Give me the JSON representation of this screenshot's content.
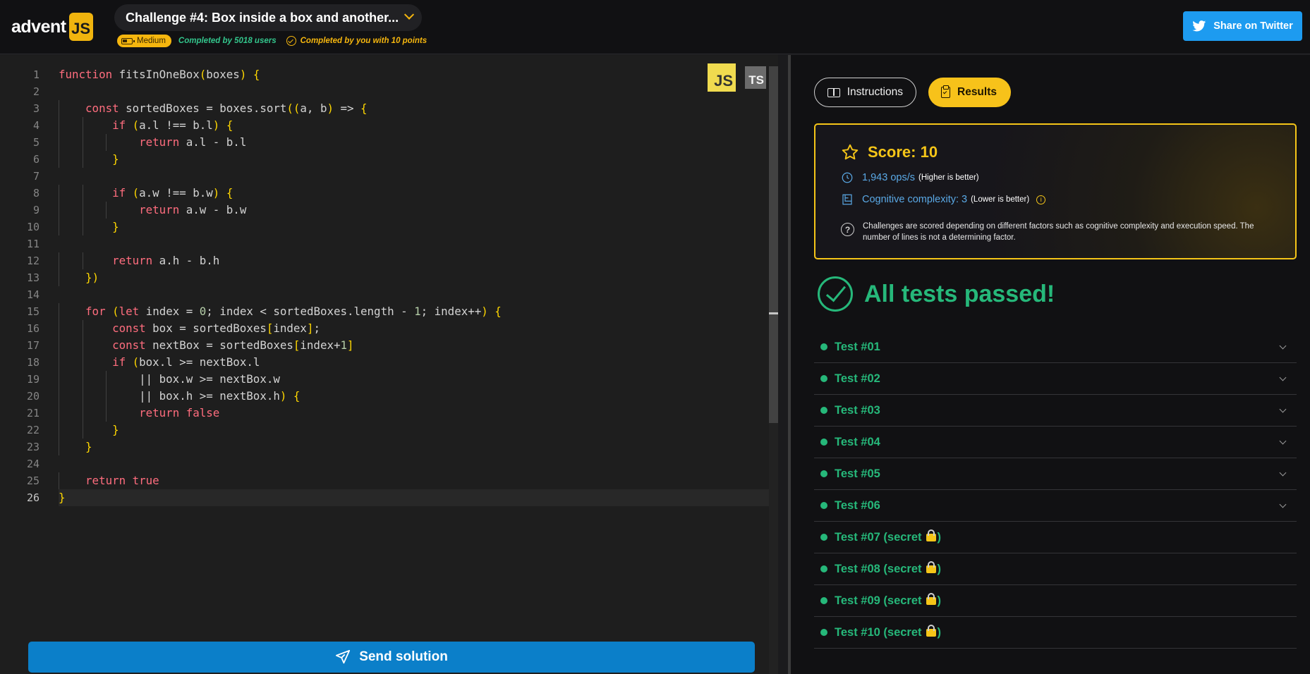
{
  "header": {
    "logo_text": "advent",
    "logo_badge": "JS",
    "challenge_title": "Challenge #4: Box inside a box and another...",
    "difficulty": "Medium",
    "completed_by_users": "Completed by 5018 users",
    "completed_by_you": "Completed by you with 10 points",
    "share_label": "Share on Twitter"
  },
  "editor": {
    "languages": [
      "JS",
      "TS"
    ],
    "active_language": "JS",
    "line_numbers": [
      "1",
      "2",
      "3",
      "4",
      "5",
      "6",
      "7",
      "8",
      "9",
      "10",
      "11",
      "12",
      "13",
      "14",
      "15",
      "16",
      "17",
      "18",
      "19",
      "20",
      "21",
      "22",
      "23",
      "24",
      "25",
      "26"
    ],
    "code_lines": [
      "function fitsInOneBox(boxes) {",
      "",
      "  const sortedBoxes = boxes.sort((a, b) => {",
      "    if (a.l !== b.l) {",
      "      return a.l - b.l",
      "    }",
      "",
      "    if (a.w !== b.w) {",
      "      return a.w - b.w",
      "    }",
      "",
      "    return a.h - b.h",
      "  })",
      "",
      "  for (let index = 0; index < sortedBoxes.length - 1; index++) {",
      "    const box = sortedBoxes[index];",
      "    const nextBox = sortedBoxes[index+1]",
      "    if (box.l >= nextBox.l",
      "      || box.w >= nextBox.w",
      "      || box.h >= nextBox.h) {",
      "      return false",
      "    }",
      "  }",
      "",
      "  return true",
      "}"
    ],
    "send_label": "Send solution"
  },
  "results": {
    "tabs": {
      "instructions": "Instructions",
      "results": "Results"
    },
    "active_tab": "Results",
    "score": "Score: 10",
    "ops": "1,943 ops/s",
    "ops_note": "(Higher is better)",
    "complexity": "Cognitive complexity: 3",
    "complexity_note": "(Lower is better)",
    "note": "Challenges are scored depending on different factors such as cognitive complexity and execution speed. The number of lines is not a determining factor.",
    "status": "All tests passed!",
    "tests": [
      {
        "label": "Test #01",
        "expandable": true
      },
      {
        "label": "Test #02",
        "expandable": true
      },
      {
        "label": "Test #03",
        "expandable": true
      },
      {
        "label": "Test #04",
        "expandable": true
      },
      {
        "label": "Test #05",
        "expandable": true
      },
      {
        "label": "Test #06",
        "expandable": true
      },
      {
        "label": "Test #07 (secret",
        "secret": true
      },
      {
        "label": "Test #08 (secret",
        "secret": true
      },
      {
        "label": "Test #09 (secret",
        "secret": true
      },
      {
        "label": "Test #10 (secret",
        "secret": true
      }
    ]
  },
  "colors": {
    "accent_yellow": "#f5c518",
    "success_green": "#26b87a",
    "send_blue": "#0b7fc9",
    "twitter_blue": "#1d9bf0"
  }
}
